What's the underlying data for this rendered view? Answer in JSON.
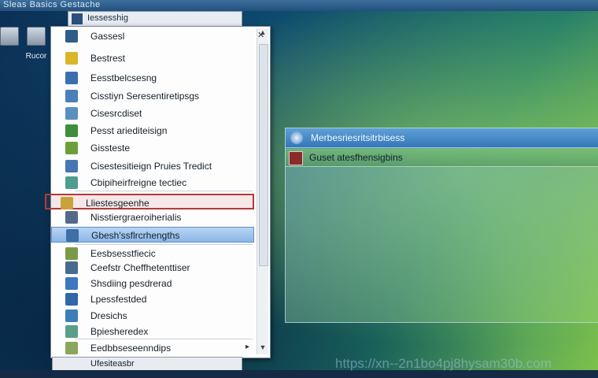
{
  "topbar": {
    "text": "Sleas Basics  Gestache"
  },
  "desktop_icons": [
    {
      "label": ""
    },
    {
      "label": "Rucor"
    }
  ],
  "menu": {
    "header_label": "Iessesshig",
    "items": [
      {
        "label": "Gassesl",
        "icon_color": "#2f5d8a",
        "state": "highlight"
      },
      {
        "label": "Bestrest",
        "icon_color": "#d9b52a"
      },
      {
        "label": "Eesstbelcsesng",
        "icon_color": "#3a6fb0"
      },
      {
        "label": "Cisstiyn Seresentiretipsgs",
        "icon_color": "#4a7fb8"
      },
      {
        "label": "Cisesrcdiset",
        "icon_color": "#5a8fc0"
      },
      {
        "label": "Pesst ariediteisign",
        "icon_color": "#3d8f3d"
      },
      {
        "label": "Gissteste",
        "icon_color": "#6c9f3a"
      },
      {
        "label": "Cisestesitieign Pruies Tredict",
        "icon_color": "#4677b0"
      },
      {
        "label": "Cbipiheirfreigne tectiec",
        "icon_color": "#4e9c8f"
      },
      {
        "label": "Lliestesgeenhe",
        "icon_color": "#c9a23a",
        "state": "red"
      },
      {
        "label": "Nisstiergraeroiherialis",
        "icon_color": "#546a88"
      },
      {
        "label": "Gbesh'ssflrcrhengths",
        "icon_color": "#3e6fa6",
        "state": "highlight"
      },
      {
        "label": "Eesbsesstfiecic",
        "icon_color": "#7a9a4a"
      },
      {
        "label": "Ceefstr Cheffhetenttiser",
        "icon_color": "#4a6a8e"
      },
      {
        "label": "Shsdiing pesdrerad",
        "icon_color": "#3b78c0"
      },
      {
        "label": "Lpessfestded",
        "icon_color": "#2f67aa"
      },
      {
        "label": "Dresichs",
        "icon_color": "#3d7eb8"
      },
      {
        "label": "Bpiesheredex",
        "icon_color": "#5a9e8a"
      }
    ],
    "footer_item": {
      "label": "Eedbbseseenndips"
    }
  },
  "bottombar": {
    "label": "Ufesiteasbr"
  },
  "window": {
    "title": "Merbesriesritsitrbisess",
    "row_label": "Guset atesfhensigbins"
  },
  "watermark": "https://xn--2n1bo4pj8hysam30b.com"
}
